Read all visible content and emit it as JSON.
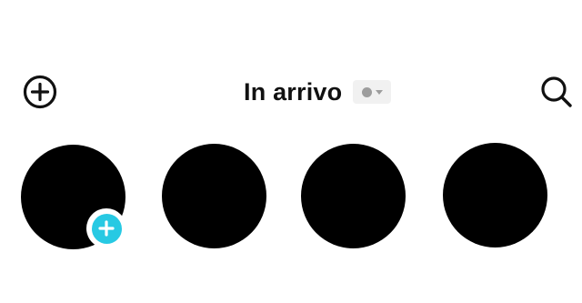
{
  "header": {
    "title": "In arrivo",
    "add_icon": "plus-circle-icon",
    "search_icon": "search-icon",
    "status": {
      "dot_color": "#9d9d9d",
      "indicator_icon": "chevron-down-icon"
    }
  },
  "stories": {
    "count": 4,
    "avatar_color": "#000000",
    "add_badge": {
      "icon": "plus-icon",
      "color": "#27c9e3"
    }
  }
}
